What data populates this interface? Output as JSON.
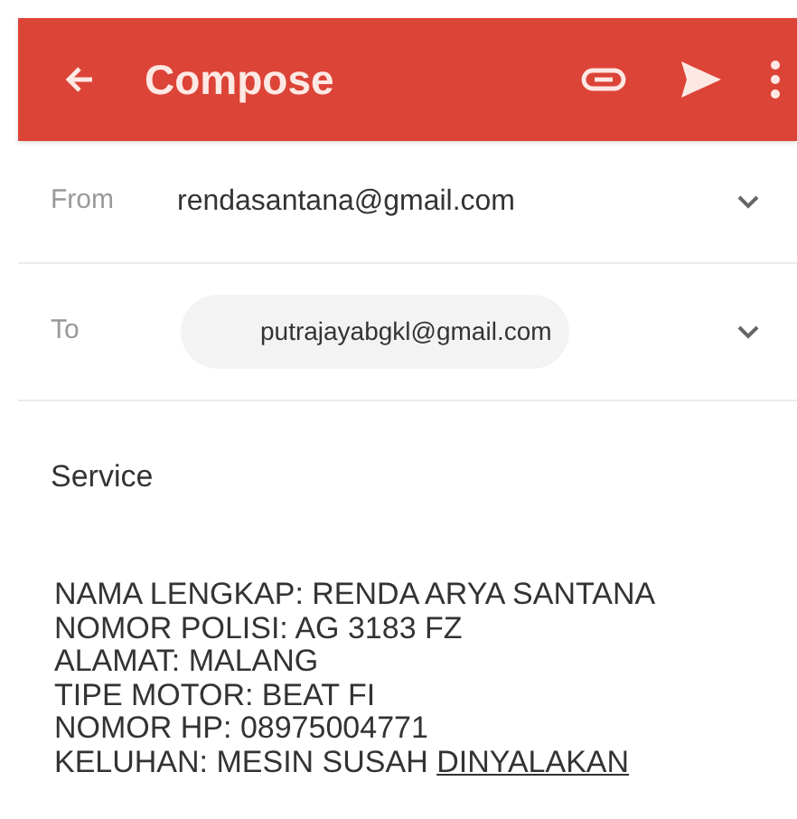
{
  "app_bar": {
    "title": "Compose"
  },
  "from": {
    "label": "From",
    "value": "rendasantana@gmail.com"
  },
  "to": {
    "label": "To",
    "recipients": [
      "putrajayabgkl@gmail.com"
    ]
  },
  "subject": {
    "value": "Service"
  },
  "body": {
    "lines": [
      [
        {
          "text": "NAMA LENGKAP: RENDA ARYA SANTANA",
          "underlined": false
        }
      ],
      [
        {
          "text": "NOMOR POLISI: AG 3183 FZ",
          "underlined": false
        }
      ],
      [
        {
          "text": "ALAMAT: MALANG",
          "underlined": false
        }
      ],
      [
        {
          "text": "TIPE MOTOR: BEAT FI",
          "underlined": false
        }
      ],
      [
        {
          "text": "NOMOR HP: 08975004771",
          "underlined": false
        }
      ],
      [
        {
          "text": "KELUHAN: MESIN SUSAH ",
          "underlined": false
        },
        {
          "text": "DINYALAKAN",
          "underlined": true
        }
      ]
    ]
  }
}
